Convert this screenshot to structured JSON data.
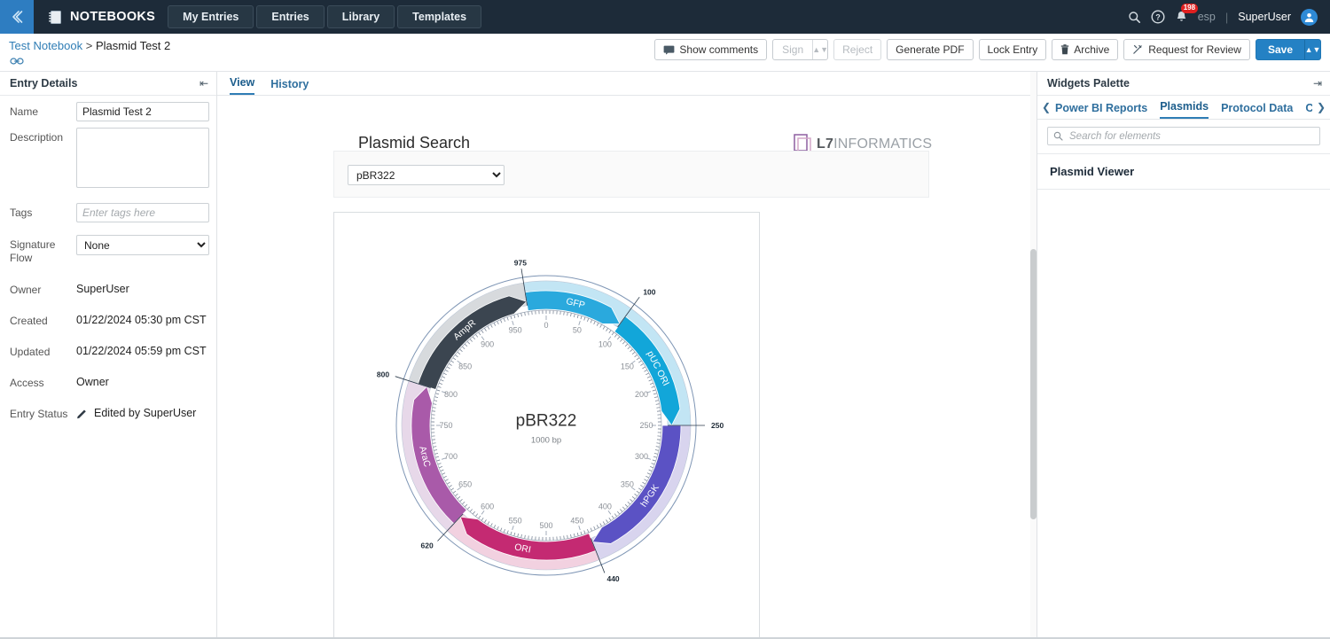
{
  "topnav": {
    "back_icon": "chevron-double-left-icon",
    "brand": "NOTEBOOKS",
    "brand_icon": "notebook-icon",
    "tabs": [
      {
        "label": "My Entries"
      },
      {
        "label": "Entries"
      },
      {
        "label": "Library"
      },
      {
        "label": "Templates"
      }
    ],
    "search_icon": "search-icon",
    "help_icon": "help-circle-icon",
    "bell_icon": "bell-icon",
    "notification_count": "198",
    "language": "esp",
    "separator": "|",
    "user": "SuperUser",
    "avatar_icon": "user-avatar-icon"
  },
  "breadcrumb": {
    "notebook": "Test Notebook",
    "separator": ">",
    "current": "Plasmid Test 2",
    "link_icon": "link-icon"
  },
  "toolbar": {
    "show_comments": "Show comments",
    "show_comments_icon": "comment-icon",
    "sign": "Sign",
    "reject": "Reject",
    "generate_pdf": "Generate PDF",
    "lock_entry": "Lock Entry",
    "archive": "Archive",
    "archive_icon": "trash-icon",
    "request_review": "Request for Review",
    "request_review_icon": "wand-icon",
    "save": "Save",
    "accent_color": "#2481c4"
  },
  "entry_details": {
    "title": "Entry Details",
    "collapse_icon": "collapse-left-icon",
    "fields": {
      "name_label": "Name",
      "name_value": "Plasmid Test 2",
      "description_label": "Description",
      "description_value": "",
      "tags_label": "Tags",
      "tags_placeholder": "Enter tags here",
      "tags_value": "",
      "signature_flow_label": "Signature Flow",
      "signature_flow_value": "None",
      "owner_label": "Owner",
      "owner_value": "SuperUser",
      "created_label": "Created",
      "created_value": "01/22/2024 05:30 pm CST",
      "updated_label": "Updated",
      "updated_value": "01/22/2024 05:59 pm CST",
      "access_label": "Access",
      "access_value": "Owner",
      "entry_status_label": "Entry Status",
      "entry_status_value": "Edited by SuperUser",
      "entry_status_icon": "pencil-icon"
    }
  },
  "center": {
    "tabs": [
      {
        "label": "View",
        "active": true
      },
      {
        "label": "History",
        "active": false
      }
    ],
    "doc_title": "Plasmid Search",
    "logo": {
      "mark": "L7",
      "rest": "INFORMATICS",
      "icon": "l7-square-icon"
    },
    "plasmid_select": {
      "value": "pBR322",
      "options": [
        "pBR322"
      ]
    }
  },
  "plasmid_map": {
    "name": "pBR322",
    "length_label": "1000 bp",
    "length_bp": 1000,
    "tick_labels": [
      0,
      50,
      100,
      150,
      200,
      250,
      300,
      350,
      400,
      450,
      500,
      550,
      600,
      650,
      700,
      750,
      800,
      850,
      900,
      950
    ],
    "outer_marks": [
      {
        "label": "975",
        "pos": 975
      },
      {
        "label": "100",
        "pos": 100
      },
      {
        "label": "250",
        "pos": 250
      },
      {
        "label": "440",
        "pos": 440
      },
      {
        "label": "620",
        "pos": 620
      },
      {
        "label": "800",
        "pos": 800
      }
    ],
    "features": [
      {
        "name": "GFP",
        "start": 975,
        "end": 100,
        "color": "#2aa9dd",
        "band_color": "#bfe4f4",
        "direction": "clockwise"
      },
      {
        "name": "pUC ORI",
        "start": 100,
        "end": 250,
        "color": "#12a6d9",
        "band_color": "#bfe4f4",
        "direction": "clockwise"
      },
      {
        "name": "hPGK",
        "start": 250,
        "end": 440,
        "color": "#5b52c4",
        "band_color": "#d6d2ee",
        "direction": "clockwise"
      },
      {
        "name": "ORI",
        "start": 440,
        "end": 620,
        "color": "#c42a72",
        "band_color": "#f2cfdf",
        "direction": "clockwise"
      },
      {
        "name": "AraC",
        "start": 620,
        "end": 800,
        "color": "#a95aa9",
        "band_color": "#e6d6e8",
        "direction": "clockwise"
      },
      {
        "name": "AmpR",
        "start": 800,
        "end": 975,
        "color": "#3b4550",
        "band_color": "#d5d9dc",
        "direction": "clockwise"
      }
    ]
  },
  "widgets_palette": {
    "title": "Widgets Palette",
    "expand_icon": "collapse-right-icon",
    "prev_icon": "chevron-left-icon",
    "next_icon": "chevron-right-icon",
    "tabs": [
      {
        "label": "Power BI Reports",
        "active": false
      },
      {
        "label": "Plasmids",
        "active": true
      },
      {
        "label": "Protocol Data",
        "active": false
      },
      {
        "label": "Ch",
        "active": false
      }
    ],
    "search_placeholder": "Search for elements",
    "search_value": "",
    "search_icon": "search-icon",
    "items": [
      {
        "label": "Plasmid Viewer"
      }
    ]
  }
}
